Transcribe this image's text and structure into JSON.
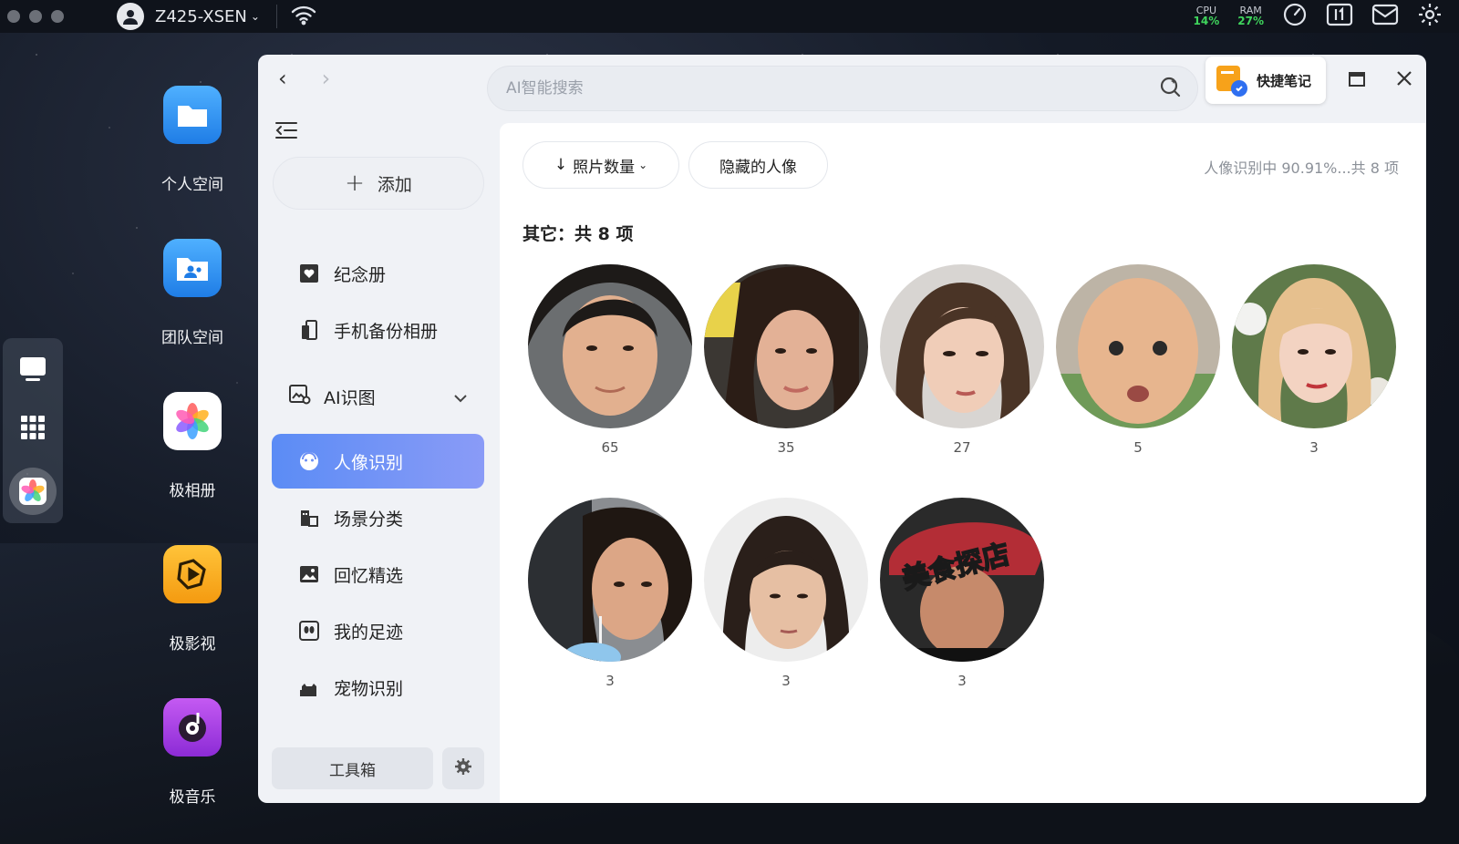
{
  "topbar": {
    "device_name": "Z425-XSEN",
    "cpu_label": "CPU",
    "cpu_value": "14%",
    "ram_label": "RAM",
    "ram_value": "27%",
    "icons": [
      "wifi-icon",
      "speed-gauge-icon",
      "resource-monitor-icon",
      "mail-icon",
      "settings-gear-icon"
    ]
  },
  "desktop": {
    "items": [
      {
        "label": "个人空间",
        "icon": "folder-icon",
        "color": "#2f8ff0"
      },
      {
        "label": "团队空间",
        "icon": "team-folder-icon",
        "color": "#2f8ff0"
      },
      {
        "label": "极相册",
        "icon": "photos-flower-icon",
        "color": "#ffffff"
      },
      {
        "label": "极影视",
        "icon": "video-icon",
        "color": "#f4a218"
      },
      {
        "label": "极音乐",
        "icon": "music-icon",
        "color": "#a53ee0"
      }
    ]
  },
  "window": {
    "search_placeholder": "AI智能搜索",
    "quick_note_label": "快捷笔记",
    "sidebar": {
      "add_label": "添加",
      "items": [
        {
          "label": "纪念册",
          "icon": "album-heart-icon"
        },
        {
          "label": "手机备份相册",
          "icon": "phone-backup-icon"
        }
      ],
      "ai_group_label": "AI识图",
      "ai_items": [
        {
          "label": "人像识别",
          "icon": "face-icon",
          "active": true
        },
        {
          "label": "场景分类",
          "icon": "scene-icon",
          "active": false
        },
        {
          "label": "回忆精选",
          "icon": "memories-icon",
          "active": false
        },
        {
          "label": "我的足迹",
          "icon": "footprint-icon",
          "active": false
        },
        {
          "label": "宠物识别",
          "icon": "pet-icon",
          "active": false
        }
      ],
      "toolbox_label": "工具箱"
    },
    "toolbar": {
      "sort_label": "照片数量",
      "hidden_label": "隐藏的人像",
      "status": "人像识别中 90.91%...共 8 项"
    },
    "section_title": "其它：共 8 项",
    "people": [
      {
        "count": "65"
      },
      {
        "count": "35"
      },
      {
        "count": "27"
      },
      {
        "count": "5"
      },
      {
        "count": "3"
      },
      {
        "count": "3"
      },
      {
        "count": "3"
      },
      {
        "count": "3",
        "caption": "美食探店"
      }
    ]
  },
  "colors": {
    "accent_start": "#5b8cf5",
    "accent_end": "#8a9bf7",
    "cpu_ram_value": "#3fd45c"
  }
}
